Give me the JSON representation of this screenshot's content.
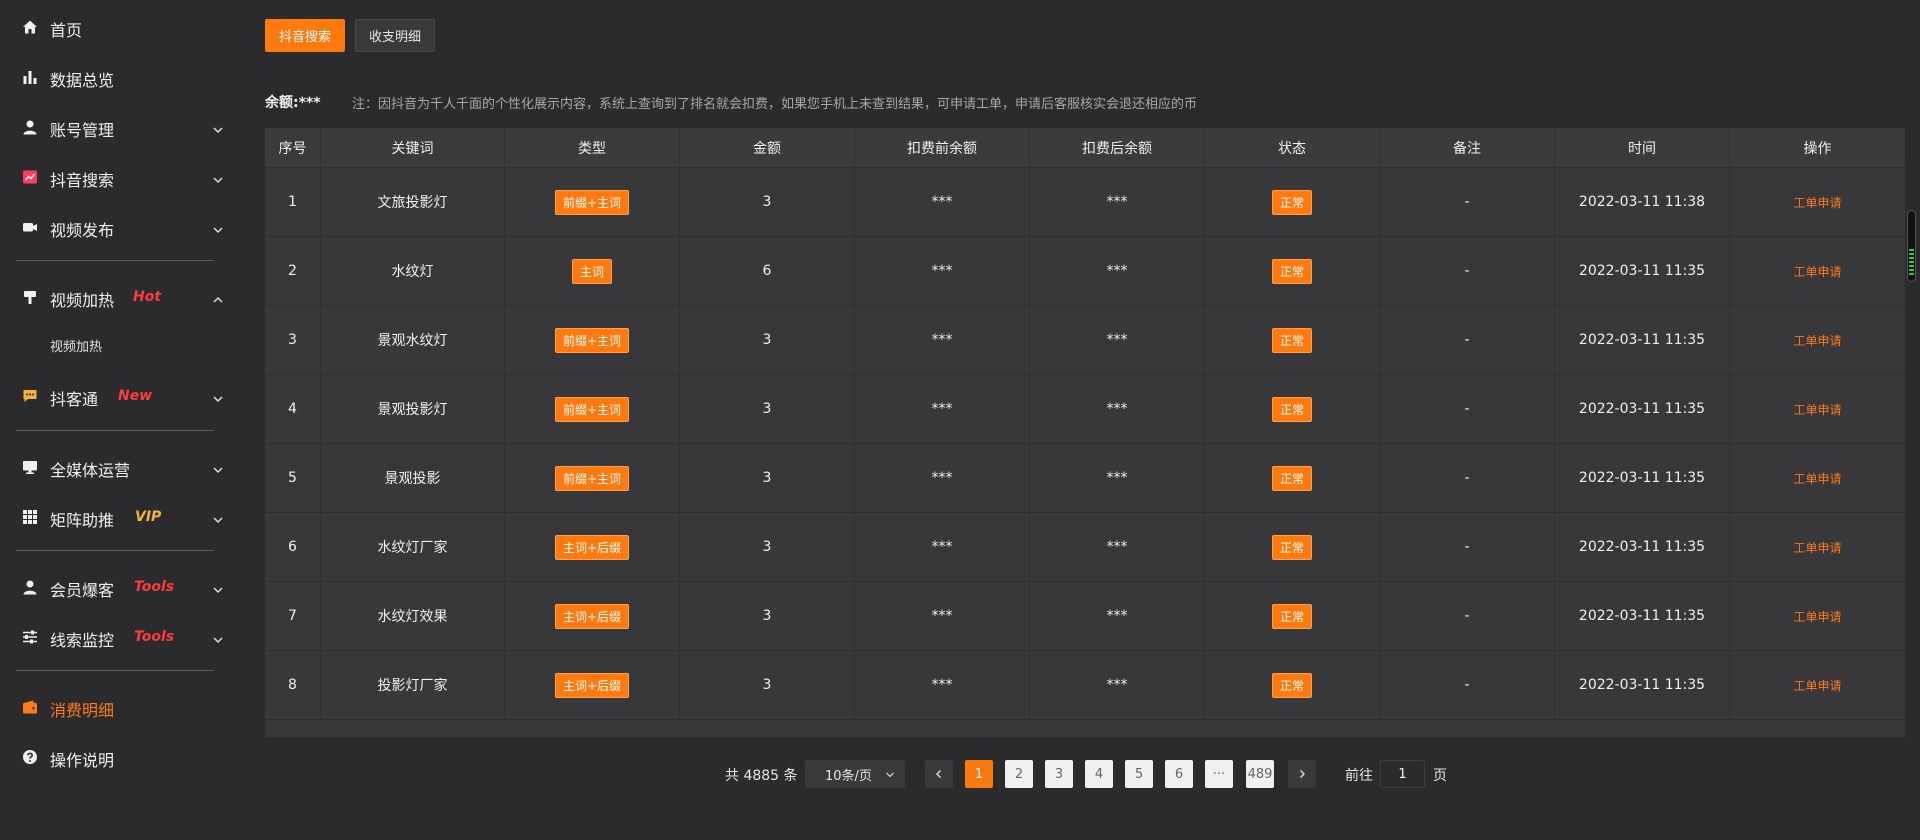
{
  "sidebar": {
    "items": [
      {
        "label": "首页",
        "icon": "home-icon"
      },
      {
        "label": "数据总览",
        "icon": "bar-chart-icon"
      },
      {
        "label": "账号管理",
        "icon": "user-icon"
      },
      {
        "label": "抖音搜索",
        "icon": "search-trend-icon"
      },
      {
        "label": "视频发布",
        "icon": "camera-icon"
      },
      {
        "label": "视频加热",
        "icon": "flame-stand-icon",
        "badge": "Hot"
      },
      {
        "label": "视频加热"
      },
      {
        "label": "抖客通",
        "icon": "chat-icon",
        "badge": "New"
      },
      {
        "label": "全媒体运营",
        "icon": "monitor-icon"
      },
      {
        "label": "矩阵助推",
        "icon": "grid-icon",
        "badge": "VIP"
      },
      {
        "label": "会员爆客",
        "icon": "member-icon",
        "badge": "Tools"
      },
      {
        "label": "线索监控",
        "icon": "sliders-icon",
        "badge": "Tools"
      },
      {
        "label": "消费明细",
        "icon": "wallet-icon"
      },
      {
        "label": "操作说明",
        "icon": "help-icon"
      }
    ]
  },
  "toolbar": {
    "tab_search": "抖音搜索",
    "tab_ledger": "收支明细"
  },
  "balance": {
    "label": "余额:",
    "value": "***"
  },
  "notice": "注：因抖音为千人千面的个性化展示内容，系统上查询到了排名就会扣费，如果您手机上未查到结果，可申请工单，申请后客服核实会退还相应的币",
  "table": {
    "headers": [
      "序号",
      "关键词",
      "类型",
      "金额",
      "扣费前余额",
      "扣费后余额",
      "状态",
      "备注",
      "时间",
      "操作"
    ],
    "rows": [
      {
        "no": "1",
        "keyword": "文旅投影灯",
        "type": "前缀+主词",
        "amount": "3",
        "before": "***",
        "after": "***",
        "status": "正常",
        "remark": "-",
        "time": "2022-03-11 11:38",
        "op": "工单申请"
      },
      {
        "no": "2",
        "keyword": "水纹灯",
        "type": "主词",
        "amount": "6",
        "before": "***",
        "after": "***",
        "status": "正常",
        "remark": "-",
        "time": "2022-03-11 11:35",
        "op": "工单申请"
      },
      {
        "no": "3",
        "keyword": "景观水纹灯",
        "type": "前缀+主词",
        "amount": "3",
        "before": "***",
        "after": "***",
        "status": "正常",
        "remark": "-",
        "time": "2022-03-11 11:35",
        "op": "工单申请"
      },
      {
        "no": "4",
        "keyword": "景观投影灯",
        "type": "前缀+主词",
        "amount": "3",
        "before": "***",
        "after": "***",
        "status": "正常",
        "remark": "-",
        "time": "2022-03-11 11:35",
        "op": "工单申请"
      },
      {
        "no": "5",
        "keyword": "景观投影",
        "type": "前缀+主词",
        "amount": "3",
        "before": "***",
        "after": "***",
        "status": "正常",
        "remark": "-",
        "time": "2022-03-11 11:35",
        "op": "工单申请"
      },
      {
        "no": "6",
        "keyword": "水纹灯厂家",
        "type": "主词+后缀",
        "amount": "3",
        "before": "***",
        "after": "***",
        "status": "正常",
        "remark": "-",
        "time": "2022-03-11 11:35",
        "op": "工单申请"
      },
      {
        "no": "7",
        "keyword": "水纹灯效果",
        "type": "主词+后缀",
        "amount": "3",
        "before": "***",
        "after": "***",
        "status": "正常",
        "remark": "-",
        "time": "2022-03-11 11:35",
        "op": "工单申请"
      },
      {
        "no": "8",
        "keyword": "投影灯厂家",
        "type": "主词+后缀",
        "amount": "3",
        "before": "***",
        "after": "***",
        "status": "正常",
        "remark": "-",
        "time": "2022-03-11 11:35",
        "op": "工单申请"
      }
    ]
  },
  "pagination": {
    "total": "共 4885 条",
    "page_size": "10条/页",
    "pages": [
      "1",
      "2",
      "3",
      "4",
      "5",
      "6",
      "···",
      "489"
    ],
    "current": "1",
    "goto_label": "前往",
    "goto_value": "1",
    "goto_unit": "页"
  },
  "colors": {
    "accent": "#ff7a0e",
    "background": "#2b2b2d",
    "table": "#38383b",
    "badge_hot": "#ff3b3b",
    "badge_vip": "#f5b33a"
  }
}
